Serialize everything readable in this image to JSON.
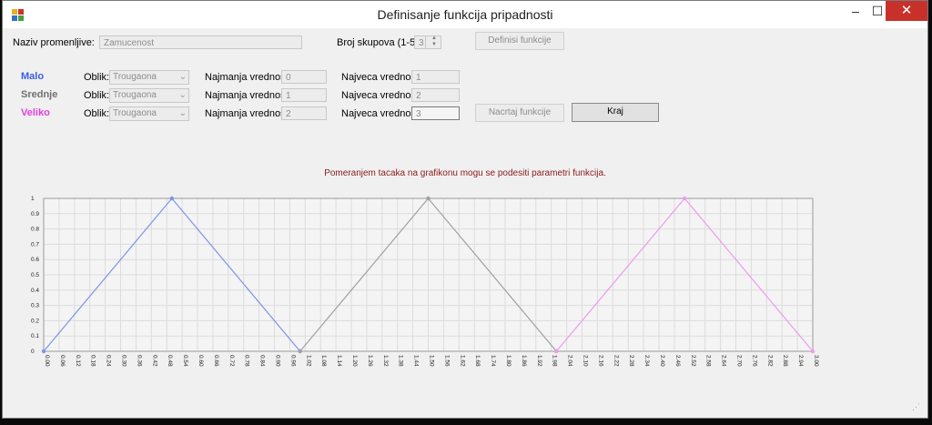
{
  "window": {
    "title": "Definisanje funkcija pripadnosti",
    "controls": {
      "minimize": "–",
      "maximize": "☐",
      "close": "✕"
    }
  },
  "form": {
    "variable_label": "Naziv promenljive:",
    "variable_value": "Zamucenost",
    "count_label": "Broj skupova (1-5):",
    "count_value": "3",
    "define_button": "Definisi funkcije",
    "draw_button": "Nacrtaj funkcije",
    "end_button": "Kraj"
  },
  "sets": [
    {
      "name": "Malo",
      "color": "#3a5fdc",
      "shape_label": "Oblik:",
      "shape": "Trougaona",
      "min_label": "Najmanja vrednost:",
      "min": "0",
      "max_label": "Najveca vrednost:",
      "max": "1"
    },
    {
      "name": "Srednje",
      "color": "#707070",
      "shape_label": "Oblik:",
      "shape": "Trougaona",
      "min_label": "Najmanja vrednost:",
      "min": "1",
      "max_label": "Najveca vrednost:",
      "max": "2"
    },
    {
      "name": "Veliko",
      "color": "#e040e0",
      "shape_label": "Oblik:",
      "shape": "Trougaona",
      "min_label": "Najmanja vrednost:",
      "min": "2",
      "max_label": "Najveca vrednost:",
      "max": "3"
    }
  ],
  "hint": "Pomeranjem tacaka na grafikonu mogu se podesiti parametri funkcija.",
  "chart_data": {
    "type": "line",
    "xlim": [
      0,
      3
    ],
    "ylim": [
      0,
      1
    ],
    "x_step": 0.06,
    "yticks": [
      "0",
      "0.1",
      "0.2",
      "0.3",
      "0.4",
      "0.5",
      "0.6",
      "0.7",
      "0.8",
      "0.9",
      "1"
    ],
    "xticks": [
      "0.00",
      "0.06",
      "0.12",
      "0.18",
      "0.24",
      "0.30",
      "0.36",
      "0.42",
      "0.48",
      "0.54",
      "0.60",
      "0.66",
      "0.72",
      "0.78",
      "0.84",
      "0.90",
      "0.96",
      "1.02",
      "1.08",
      "1.14",
      "1.20",
      "1.26",
      "1.32",
      "1.38",
      "1.44",
      "1.50",
      "1.56",
      "1.62",
      "1.68",
      "1.74",
      "1.80",
      "1.86",
      "1.92",
      "1.98",
      "2.04",
      "2.10",
      "2.16",
      "2.22",
      "2.28",
      "2.34",
      "2.40",
      "2.46",
      "2.52",
      "2.58",
      "2.64",
      "2.70",
      "2.76",
      "2.82",
      "2.88",
      "2.94",
      "3.00"
    ],
    "grid": true,
    "series": [
      {
        "name": "Malo",
        "color": "#7b95e8",
        "points": [
          [
            0,
            0
          ],
          [
            0.5,
            1
          ],
          [
            1,
            0
          ]
        ]
      },
      {
        "name": "Srednje",
        "color": "#a0a0a0",
        "points": [
          [
            1,
            0
          ],
          [
            1.5,
            1
          ],
          [
            2,
            0
          ]
        ]
      },
      {
        "name": "Veliko",
        "color": "#ee9aee",
        "points": [
          [
            2,
            0
          ],
          [
            2.5,
            1
          ],
          [
            3,
            0
          ]
        ]
      }
    ]
  }
}
